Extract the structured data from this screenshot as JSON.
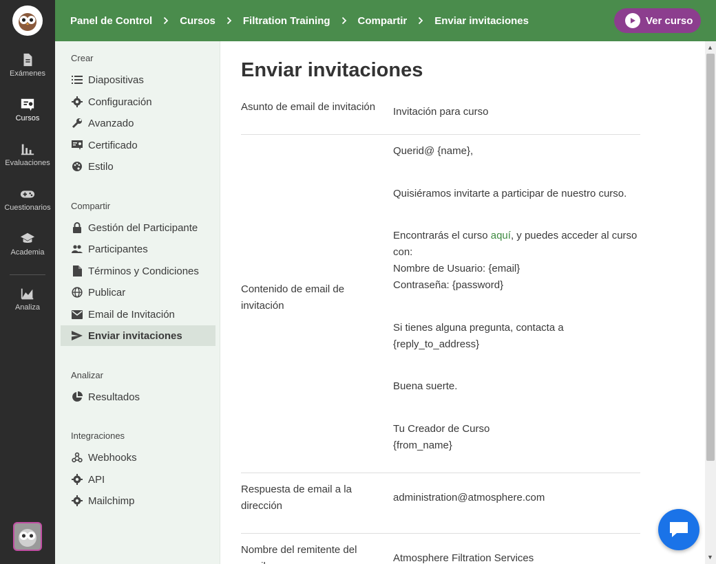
{
  "breadcrumb": [
    "Panel de Control",
    "Cursos",
    "Filtration Training",
    "Compartir",
    "Enviar invitaciones"
  ],
  "view_course_label": "Ver curso",
  "rail": {
    "items": [
      {
        "label": "Exámenes",
        "icon": "document-icon"
      },
      {
        "label": "Cursos",
        "icon": "course-icon",
        "active": true
      },
      {
        "label": "Evaluaciones",
        "icon": "bar-chart-icon"
      },
      {
        "label": "Cuestionarios",
        "icon": "gamepad-icon"
      },
      {
        "label": "Academia",
        "icon": "graduation-cap-icon"
      },
      {
        "label": "Analiza",
        "icon": "area-chart-icon"
      }
    ]
  },
  "side": {
    "sections": [
      {
        "title": "Crear",
        "items": [
          {
            "label": "Diapositivas",
            "icon": "list-icon"
          },
          {
            "label": "Configuración",
            "icon": "gear-icon"
          },
          {
            "label": "Avanzado",
            "icon": "wrench-icon"
          },
          {
            "label": "Certificado",
            "icon": "certificate-icon"
          },
          {
            "label": "Estilo",
            "icon": "palette-icon"
          }
        ]
      },
      {
        "title": "Compartir",
        "items": [
          {
            "label": "Gestión del Participante",
            "icon": "lock-icon"
          },
          {
            "label": "Participantes",
            "icon": "people-icon"
          },
          {
            "label": "Términos y Condiciones",
            "icon": "file-icon"
          },
          {
            "label": "Publicar",
            "icon": "globe-icon"
          },
          {
            "label": "Email de Invitación",
            "icon": "mail-icon"
          },
          {
            "label": "Enviar invitaciones",
            "icon": "send-icon",
            "active": true
          }
        ]
      },
      {
        "title": "Analizar",
        "items": [
          {
            "label": "Resultados",
            "icon": "pie-chart-icon"
          }
        ]
      },
      {
        "title": "Integraciones",
        "items": [
          {
            "label": "Webhooks",
            "icon": "webhook-icon"
          },
          {
            "label": "API",
            "icon": "gear-icon"
          },
          {
            "label": "Mailchimp",
            "icon": "gear-icon"
          }
        ]
      }
    ]
  },
  "page_title": "Enviar invitaciones",
  "fields": {
    "subject": {
      "label": "Asunto de email de invitación",
      "value": "Invitación para curso"
    },
    "content": {
      "label": "Contenido de email de invitación",
      "greeting": "Querid@ {name},",
      "intro": "Quisiéramos invitarte a participar de nuestro curso.",
      "find_pre": "Encontrarás el curso ",
      "find_link": "aquí",
      "find_post": ", y puedes acceder al curso con:",
      "username": "Nombre de Usuario: {email}",
      "password": "Contraseña: {password}",
      "questions": "Si tienes alguna pregunta, contacta a {reply_to_address}",
      "luck": "Buena suerte.",
      "signoff": "Tu Creador de Curso",
      "from_name": "{from_name}"
    },
    "reply_to": {
      "label": "Respuesta de email a la dirección",
      "value": "administration@atmosphere.com"
    },
    "sender": {
      "label": "Nombre del remitente del email",
      "value": "Atmosphere Filtration Services"
    }
  }
}
